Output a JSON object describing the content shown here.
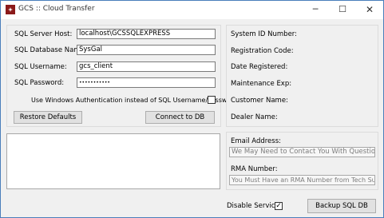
{
  "window": {
    "title": "GCS :: Cloud Transfer",
    "minimize": "─",
    "maximize": "☐",
    "close": "✕"
  },
  "sql": {
    "server_label": "SQL Server Host:",
    "server_value": "localhost\\GCSSQLEXPRESS",
    "database_label": "SQL Database Name:",
    "database_value": "SysGal",
    "username_label": "SQL Username:",
    "username_value": "gcs_client",
    "password_label": "SQL Password:",
    "password_value": "•••••••••••",
    "windows_auth_label": "Use Windows Authentication instead of SQL Username/Password",
    "windows_auth_checked": false,
    "restore_defaults": "Restore Defaults",
    "connect": "Connect to DB"
  },
  "info": {
    "system_id": "System ID Number:",
    "registration_code": "Registration Code:",
    "date_registered": "Date Registered:",
    "maintenance_exp": "Maintenance Exp:",
    "customer_name": "Customer Name:",
    "dealer_name": "Dealer Name:"
  },
  "contact": {
    "email_label": "Email Address:",
    "email_placeholder": "We May Need to Contact You With Questions...",
    "rma_label": "RMA Number:",
    "rma_placeholder": "You Must Have an RMA Number from Tech Support"
  },
  "footer": {
    "disable_services": "Disable Services",
    "disable_services_checked": true,
    "backup": "Backup SQL DB"
  }
}
